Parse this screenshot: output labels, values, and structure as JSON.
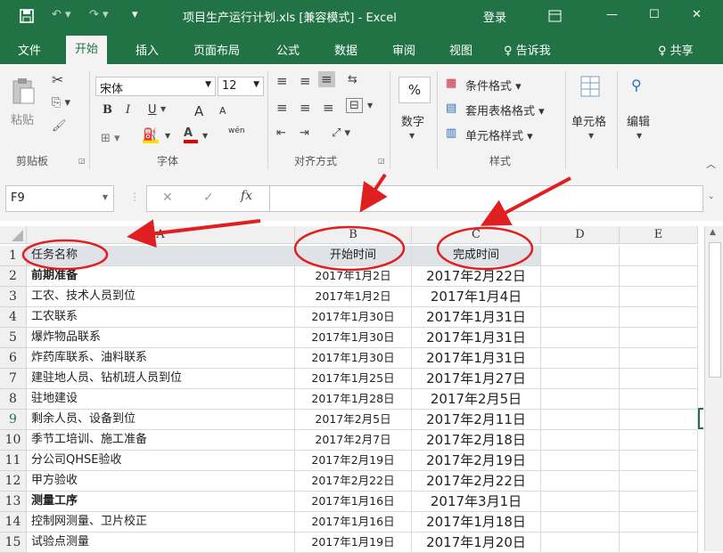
{
  "titlebar": {
    "save_icon": "save-icon",
    "undo_icon": "undo-icon",
    "redo_icon": "redo-icon",
    "title": "项目生产运行计划.xls  [兼容模式]  -  Excel",
    "login": "登录",
    "controls": [
      "—",
      "☐",
      "✕"
    ]
  },
  "tabs": [
    "文件",
    "开始",
    "插入",
    "页面布局",
    "公式",
    "数据",
    "审阅",
    "视图",
    "♀ 告诉我"
  ],
  "share": "共享",
  "ribbon": {
    "paste": "粘贴",
    "clipboard": "剪贴板",
    "font_name": "宋体",
    "font_size": "12",
    "font_group": "字体",
    "bold": "B",
    "italic": "I",
    "underline": "U",
    "grow": "A",
    "shrink": "A",
    "phonetic": "wén",
    "align_group": "对齐方式",
    "number_pct": "%",
    "number_label": "数字",
    "cond_format": "条件格式",
    "table_format": "套用表格格式",
    "cell_style": "单元格样式",
    "styles_group": "样式",
    "cells": "单元格",
    "edit": "编辑"
  },
  "formula": {
    "namebox": "F9",
    "cancel": "✕",
    "enter": "✓",
    "fx": "fx",
    "value": ""
  },
  "columns": [
    "A",
    "B",
    "C",
    "D",
    "E"
  ],
  "rows": [
    {
      "n": "1",
      "a": "任务名称",
      "b": "开始时间",
      "c": "完成时间"
    },
    {
      "n": "2",
      "a": "前期准备",
      "b": "2017年1月2日",
      "c": "2017年2月22日",
      "bold": true
    },
    {
      "n": "3",
      "a": "工农、技术人员到位",
      "b": "2017年1月2日",
      "c": "2017年1月4日"
    },
    {
      "n": "4",
      "a": "工农联系",
      "b": "2017年1月30日",
      "c": "2017年1月31日"
    },
    {
      "n": "5",
      "a": "爆炸物品联系",
      "b": "2017年1月30日",
      "c": "2017年1月31日"
    },
    {
      "n": "6",
      "a": "炸药库联系、油料联系",
      "b": "2017年1月30日",
      "c": "2017年1月31日"
    },
    {
      "n": "7",
      "a": "建驻地人员、钻机班人员到位",
      "b": "2017年1月25日",
      "c": "2017年1月27日"
    },
    {
      "n": "8",
      "a": "驻地建设",
      "b": "2017年1月28日",
      "c": "2017年2月5日"
    },
    {
      "n": "9",
      "a": "剩余人员、设备到位",
      "b": "2017年2月5日",
      "c": "2017年2月11日"
    },
    {
      "n": "10",
      "a": "季节工培训、施工准备",
      "b": "2017年2月7日",
      "c": "2017年2月18日"
    },
    {
      "n": "11",
      "a": "分公司QHSE验收",
      "b": "2017年2月19日",
      "c": "2017年2月19日"
    },
    {
      "n": "12",
      "a": "甲方验收",
      "b": "2017年2月22日",
      "c": "2017年2月22日"
    },
    {
      "n": "13",
      "a": "测量工序",
      "b": "2017年1月16日",
      "c": "2017年3月1日",
      "bold": true
    },
    {
      "n": "14",
      "a": "控制网测量、卫片校正",
      "b": "2017年1月16日",
      "c": "2017年1月18日"
    },
    {
      "n": "15",
      "a": "试验点测量",
      "b": "2017年1月19日",
      "c": "2017年1月20日"
    }
  ],
  "colors": {
    "excel_green": "#217346",
    "annotation_red": "#e02020"
  }
}
